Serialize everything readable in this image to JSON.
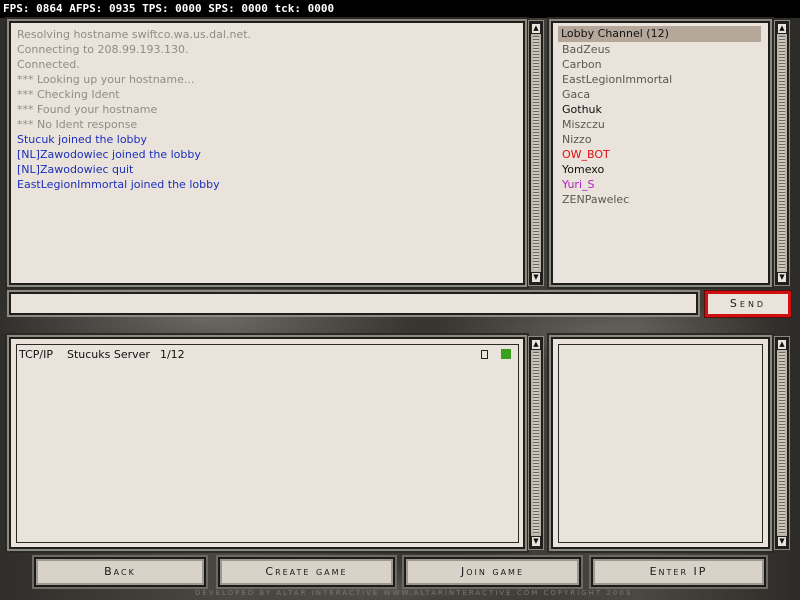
{
  "stats_bar": "FPS: 0864 AFPS: 0935 TPS: 0000 SPS: 0000 tck: 0000",
  "chat": {
    "lines": [
      {
        "text": "Resolving hostname swiftco.wa.us.dal.net.",
        "color": "#8f8c86"
      },
      {
        "text": "Connecting to 208.99.193.130.",
        "color": "#8f8c86"
      },
      {
        "text": "Connected.",
        "color": "#8f8c86"
      },
      {
        "text": "*** Looking up your hostname...",
        "color": "#8f8c86"
      },
      {
        "text": "*** Checking Ident",
        "color": "#8f8c86"
      },
      {
        "text": "*** Found your hostname",
        "color": "#8f8c86"
      },
      {
        "text": "*** No Ident response",
        "color": "#8f8c86"
      },
      {
        "text": "Stucuk joined the lobby",
        "color": "#1b2fb8"
      },
      {
        "text": "[NL]Zawodowiec joined the lobby",
        "color": "#1b2fb8"
      },
      {
        "text": "[NL]Zawodowiec quit",
        "color": "#1b2fb8"
      },
      {
        "text": "EastLegionImmortal joined the lobby",
        "color": "#1b2fb8"
      }
    ]
  },
  "users": {
    "header": "Lobby Channel (12)",
    "list": [
      {
        "name": "BadZeus",
        "color": "#5a5752"
      },
      {
        "name": "Carbon",
        "color": "#5a5752"
      },
      {
        "name": "EastLegionImmortal",
        "color": "#5a5752"
      },
      {
        "name": "Gaca",
        "color": "#5a5752"
      },
      {
        "name": "Gothuk",
        "color": "#111111"
      },
      {
        "name": "Miszczu",
        "color": "#5a5752"
      },
      {
        "name": "Nizzo",
        "color": "#5a5752"
      },
      {
        "name": "OW_BOT",
        "color": "#e01010"
      },
      {
        "name": "Yomexo",
        "color": "#111111"
      },
      {
        "name": "Yuri_S",
        "color": "#b020c0"
      },
      {
        "name": "ZENPawelec",
        "color": "#5a5752"
      }
    ]
  },
  "send_label": "Send",
  "games": [
    {
      "protocol": "TCP/IP",
      "name": "Stucuks Server",
      "players": "1/12",
      "status_color": "#3aa020"
    }
  ],
  "buttons": {
    "back": "Back",
    "create": "Create game",
    "join": "Join game",
    "enter_ip": "Enter IP"
  },
  "footer": "DEVELOPED BY ALTAR INTERACTIVE     WWW.ALTARINTERACTIVE.COM    COPYRIGHT 2003"
}
